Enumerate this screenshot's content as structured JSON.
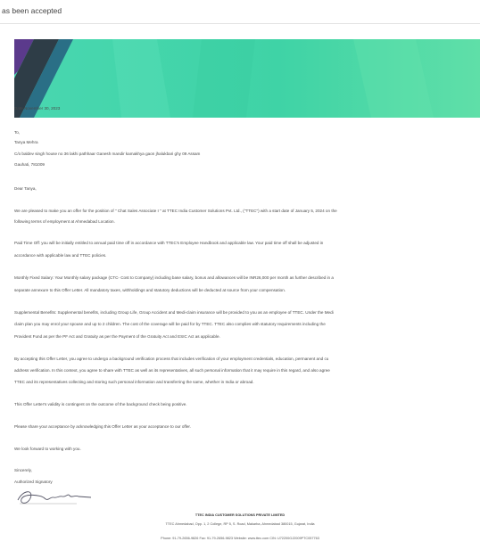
{
  "topbar": {
    "status_text": "as been accepted"
  },
  "letter": {
    "date": "Date November 30, 2023",
    "to": "To,",
    "name": "Tanya Mehra",
    "address_1": "C/o baldev singh house no 36 lakhi pathhaar Ganesh mandir kamakhya gaon jhalukbari ghy 09 Assam",
    "address_2": "Gauhati, 781009",
    "salutation": "Dear Tanya,",
    "intro_1": "We are pleased to make you an offer for the position of \" Chat Sales Associate I \" at TTEC India Customer Solutions Pvt. Ltd., (\"TTEC\") with a start date of January 5, 2024 on the",
    "intro_2": "following terms of employment at Ahmedabad Location.",
    "pto_1": "Paid Time Off: you will be initially entitled to annual paid time off in accordance with TTEC's Employee Handbook and applicable law. Your paid time off shall be adjusted in",
    "pto_2": "accordance with applicable law and TTEC policies.",
    "salary_1": "Monthly Fixed Salary: Your Monthly salary package (CTC- Cost to Company) including base salary, bonus and allowances will be INR26,000 per month as further described in a",
    "salary_2": "separate annexure to this Offer Letter. All mandatory taxes, withholdings and statutory deductions will be deducted at source from your compensation.",
    "benefits_1": "Supplemental Benefits: Supplemental benefits, including Group Life, Group Accident and Medi-claim insurance will be provided to you as an employee of TTEC. Under the Medi",
    "benefits_2": "claim plan you may enrol your spouse and up to 2 children. The cost of the coverage will be paid for by TTEC. TTEC also complies with statutory requirements including the",
    "benefits_3": "Provident Fund as per the PF Act and Gratuity as per the Payment of the Gratuity Act and ESIC Act as applicable.",
    "bg_1": "By accepting this Offer Letter, you agree to undergo a background verification process that includes verification of your employment credentials, education, permanent and cu",
    "bg_2": "address verification. In this context, you agree to share with TTEC as well as its representatives, all such personal information that it may require in this regard, and also agree",
    "bg_3": "TTEC and its representatives collecting and storing such personal information and transferring the same, whether in India or abroad.",
    "validity": "This Offer Letter's validity is contingent on the outcome of the background check being positive.",
    "acceptance": "Please share your acceptance by acknowledging this Offer Letter as your acceptance to our offer.",
    "look_forward": "We look forward to working with you.",
    "sincerely": "Sincerely,",
    "signatory": "Authorized Signatory",
    "footer_company": "TTEC INDIA CUSTOMER SOLUTIONS PRIVATE LIMITED",
    "footer_address": "TTEC Ahmedabad, Opp. 1, 2 College, RP 5, S. Road, Makarba, Ahmedabad 380015, Gujarat, India",
    "footer_contact": "Phone: 91-79-2656-9826  Fax: 91-79-2656-9823  Website: www.ttec.com  CIN: U72200GJ2009PTC057763"
  },
  "colors": {
    "banner_green": "#3fd3a6",
    "banner_dark": "#2e3d47",
    "banner_purple": "#5b3a8c"
  }
}
